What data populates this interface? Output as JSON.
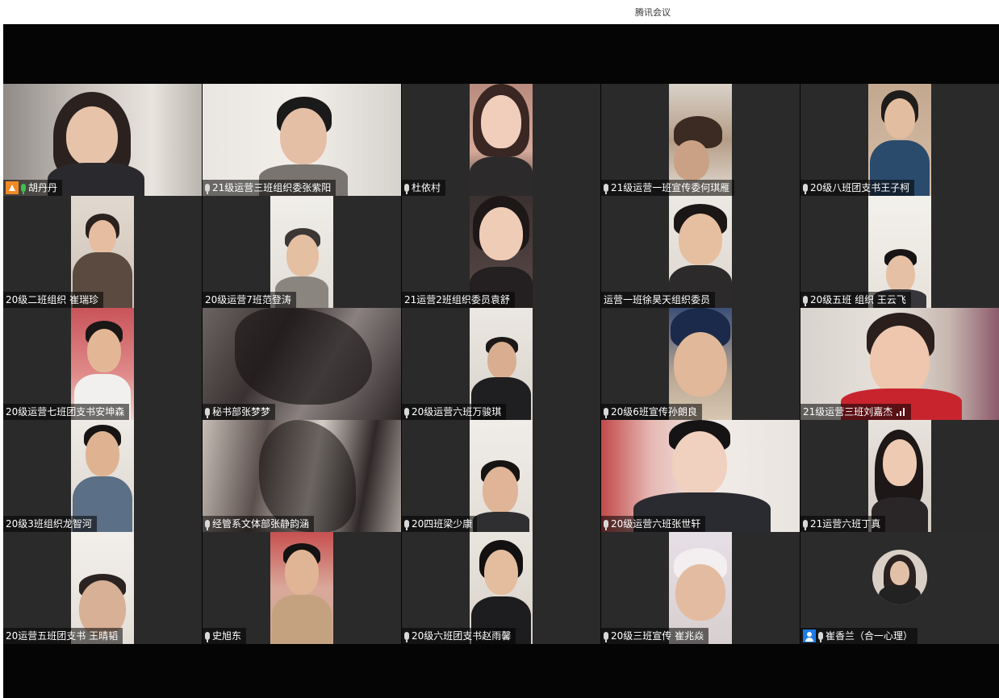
{
  "window": {
    "title": "腾讯会议"
  },
  "participants": [
    {
      "name": "胡丹丹",
      "badge": "host",
      "mic": "green"
    },
    {
      "name": "21级运营三班组织委张紫阳",
      "mic": "gray"
    },
    {
      "name": "杜依村",
      "mic": "gray"
    },
    {
      "name": "21级运营一班宣传委何琪雁",
      "mic": "gray"
    },
    {
      "name": "20级八班团支书王子柯",
      "mic": "gray"
    },
    {
      "name": "20级二班组织 崔瑞珍",
      "mic": "none"
    },
    {
      "name": "20级运营7班范登涛",
      "mic": "none"
    },
    {
      "name": "21运营2班组织委员袁舒",
      "mic": "none"
    },
    {
      "name": "运营一班徐昊天组织委员",
      "mic": "none"
    },
    {
      "name": "20级五班 组织 王云飞",
      "mic": "gray"
    },
    {
      "name": "20级运营七班团支书安坤森",
      "mic": "none"
    },
    {
      "name": "秘书部张梦梦",
      "mic": "gray"
    },
    {
      "name": "20级运营六班万骏琪",
      "mic": "gray"
    },
    {
      "name": "20级6班宣传孙朗良",
      "mic": "gray"
    },
    {
      "name": "21级运营三班刘嘉杰",
      "mic": "none",
      "signal": true
    },
    {
      "name": "20级3班组织龙智河",
      "mic": "none"
    },
    {
      "name": "经管系文体部张静韵涵",
      "mic": "gray"
    },
    {
      "name": "20四班梁少康",
      "mic": "gray"
    },
    {
      "name": "20级运营六班张世轩",
      "mic": "gray"
    },
    {
      "name": "21运营六班丁真",
      "mic": "gray"
    },
    {
      "name": "20运营五班团支书 王晴韬",
      "mic": "none"
    },
    {
      "name": "史旭东",
      "mic": "gray"
    },
    {
      "name": "20级六班团支书赵雨馨",
      "mic": "gray"
    },
    {
      "name": "20级三班宣传 崔兆焱",
      "mic": "gray"
    },
    {
      "name": "崔香兰（合一心理）",
      "badge": "user",
      "mic": "gray"
    }
  ]
}
